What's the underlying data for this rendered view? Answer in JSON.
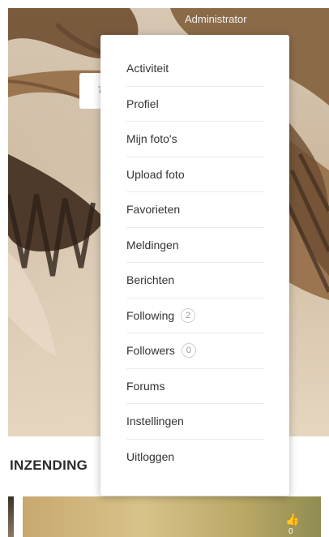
{
  "header": {
    "role_label": "Administrator"
  },
  "search": {
    "placeholder_fragment": "Ty"
  },
  "menu": {
    "items": [
      {
        "label": "Activiteit"
      },
      {
        "label": "Profiel"
      },
      {
        "label": "Mijn foto's"
      },
      {
        "label": "Upload foto"
      },
      {
        "label": "Favorieten"
      },
      {
        "label": "Meldingen"
      },
      {
        "label": "Berichten"
      },
      {
        "label": "Following",
        "count": "2"
      },
      {
        "label": "Followers",
        "count": "0"
      },
      {
        "label": "Forums"
      },
      {
        "label": "Instellingen"
      },
      {
        "label": "Uitloggen"
      }
    ]
  },
  "section": {
    "title": "INZENDING"
  },
  "card": {
    "like_icon": "thumbs-up-icon",
    "like_count": "0"
  },
  "colors": {
    "menu_bg": "#ffffff",
    "text": "#333333",
    "badge_border": "#cfcfcf"
  }
}
